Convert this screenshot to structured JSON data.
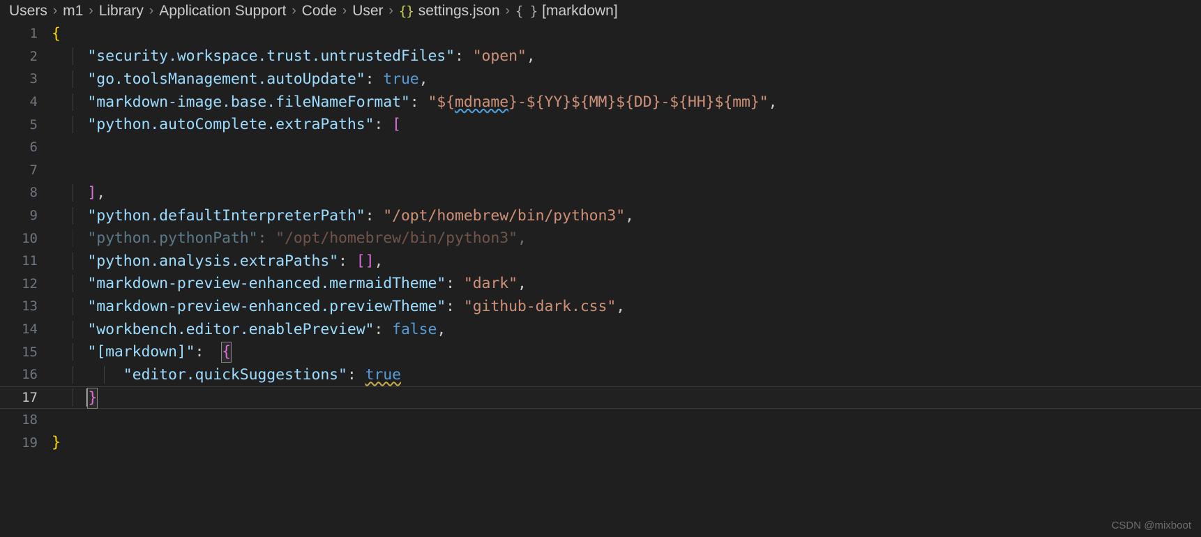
{
  "breadcrumb": {
    "separator": "›",
    "items": [
      {
        "label": "Users",
        "icon": null
      },
      {
        "label": "m1",
        "icon": null
      },
      {
        "label": "Library",
        "icon": null
      },
      {
        "label": "Application Support",
        "icon": null
      },
      {
        "label": "Code",
        "icon": null
      },
      {
        "label": "User",
        "icon": null
      },
      {
        "label": "settings.json",
        "icon": "json-braces-icon",
        "icon_glyph": "{}",
        "icon_color": "#cdcd5a"
      },
      {
        "label": "[markdown]",
        "icon": "object-braces-icon",
        "icon_glyph": "{ }",
        "icon_color": "#b0b0b0"
      }
    ]
  },
  "editor": {
    "language": "json",
    "theme": "dark-modern",
    "active_line": 17,
    "line_numbers": [
      "1",
      "2",
      "3",
      "4",
      "5",
      "6",
      "7",
      "8",
      "9",
      "10",
      "11",
      "12",
      "13",
      "14",
      "15",
      "16",
      "17",
      "18",
      "19"
    ],
    "lines": [
      {
        "n": 1,
        "text": "{"
      },
      {
        "n": 2,
        "key": "\"security.workspace.trust.untrustedFiles\"",
        "value": "\"open\"",
        "text": "    \"security.workspace.trust.untrustedFiles\": \"open\","
      },
      {
        "n": 3,
        "key": "\"go.toolsManagement.autoUpdate\"",
        "value": "true",
        "text": "    \"go.toolsManagement.autoUpdate\": true,"
      },
      {
        "n": 4,
        "key": "\"markdown-image.base.fileNameFormat\"",
        "value": "\"${mdname}-${YY}${MM}${DD}-${HH}${mm}\"",
        "text": "    \"markdown-image.base.fileNameFormat\": \"${mdname}-${YY}${MM}${DD}-${HH}${mm}\","
      },
      {
        "n": 5,
        "key": "\"python.autoComplete.extraPaths\"",
        "value": "[",
        "text": "    \"python.autoComplete.extraPaths\": ["
      },
      {
        "n": 6,
        "text": ""
      },
      {
        "n": 7,
        "text": ""
      },
      {
        "n": 8,
        "text": "    ],"
      },
      {
        "n": 9,
        "key": "\"python.defaultInterpreterPath\"",
        "value": "\"/opt/homebrew/bin/python3\"",
        "text": "    \"python.defaultInterpreterPath\": \"/opt/homebrew/bin/python3\","
      },
      {
        "n": 10,
        "key": "\"python.pythonPath\"",
        "value": "\"/opt/homebrew/bin/python3\"",
        "text": "    \"python.pythonPath\": \"/opt/homebrew/bin/python3\",",
        "deprecated": true
      },
      {
        "n": 11,
        "key": "\"python.analysis.extraPaths\"",
        "value": "[]",
        "text": "    \"python.analysis.extraPaths\": [],"
      },
      {
        "n": 12,
        "key": "\"markdown-preview-enhanced.mermaidTheme\"",
        "value": "\"dark\"",
        "text": "    \"markdown-preview-enhanced.mermaidTheme\": \"dark\","
      },
      {
        "n": 13,
        "key": "\"markdown-preview-enhanced.previewTheme\"",
        "value": "\"github-dark.css\"",
        "text": "    \"markdown-preview-enhanced.previewTheme\": \"github-dark.css\","
      },
      {
        "n": 14,
        "key": "\"workbench.editor.enablePreview\"",
        "value": "false",
        "text": "    \"workbench.editor.enablePreview\": false,"
      },
      {
        "n": 15,
        "key": "\"[markdown]\"",
        "value": "{",
        "text": "    \"[markdown]\":  {"
      },
      {
        "n": 16,
        "key": "\"editor.quickSuggestions\"",
        "value": "true",
        "text": "        \"editor.quickSuggestions\": true"
      },
      {
        "n": 17,
        "text": "    }"
      },
      {
        "n": 18,
        "text": ""
      },
      {
        "n": 19,
        "text": "}"
      }
    ],
    "tokens": {
      "line1_brace": "{",
      "line2_key": "\"security.workspace.trust.untrustedFiles\"",
      "line2_colon": ": ",
      "line2_val": "\"open\"",
      "line2_comma": ",",
      "line3_key": "\"go.toolsManagement.autoUpdate\"",
      "line3_val": "true",
      "line4_key": "\"markdown-image.base.fileNameFormat\"",
      "line4_val_pre": "\"${",
      "line4_val_squig": "mdname",
      "line4_val_post": "}-${YY}${MM}${DD}-${HH}${mm}\"",
      "line5_key": "\"python.autoComplete.extraPaths\"",
      "line5_val": "[",
      "line8_val": "]",
      "line9_key": "\"python.defaultInterpreterPath\"",
      "line9_val": "\"/opt/homebrew/bin/python3\"",
      "line10_key": "\"python.pythonPath\"",
      "line10_val": "\"/opt/homebrew/bin/python3\"",
      "line11_key": "\"python.analysis.extraPaths\"",
      "line11_val": "[]",
      "line12_key": "\"markdown-preview-enhanced.mermaidTheme\"",
      "line12_val": "\"dark\"",
      "line13_key": "\"markdown-preview-enhanced.previewTheme\"",
      "line13_val": "\"github-dark.css\"",
      "line14_key": "\"workbench.editor.enablePreview\"",
      "line14_val": "false",
      "line15_key": "\"[markdown]\"",
      "line15_val": "{",
      "line16_key": "\"editor.quickSuggestions\"",
      "line16_val": "true",
      "line17_val": "}",
      "line19_val": "}",
      "colon": ":",
      "comma": ",",
      "space": " ",
      "indent1": "    ",
      "indent2": "        ",
      "gap2": "  "
    }
  },
  "watermark": {
    "text": "CSDN @mixboot"
  },
  "colors": {
    "background": "#1f1f1f",
    "key": "#9cdcfe",
    "string": "#ce9178",
    "boolean": "#569cd6",
    "punctuation": "#cccccc",
    "bracket_level1": "#ffd700",
    "bracket_level2": "#da70d6",
    "line_number": "#6e7681",
    "line_number_active": "#cccccc",
    "squiggle": "#4f9fd8",
    "current_line_border": "#3a3a3a"
  }
}
